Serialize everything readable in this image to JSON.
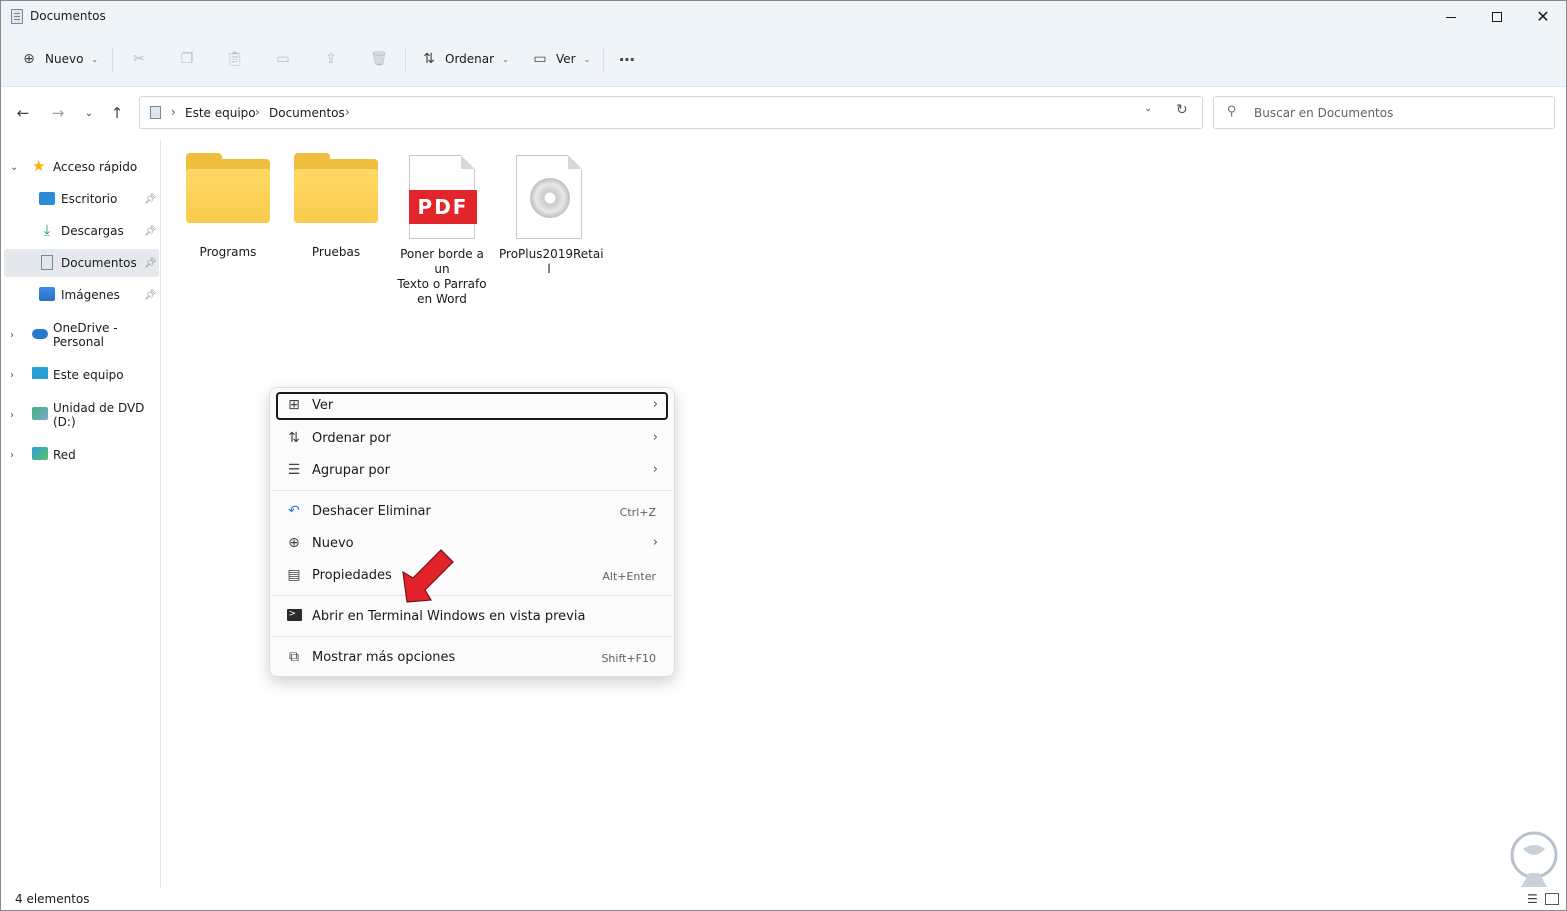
{
  "window": {
    "title": "Documentos"
  },
  "toolbar": {
    "new_label": "Nuevo",
    "sort_label": "Ordenar",
    "view_label": "Ver",
    "icons": [
      "add-icon",
      "cut-icon",
      "copy-icon",
      "paste-icon",
      "rename-icon",
      "share-icon",
      "delete-icon",
      "sort-icon",
      "view-icon",
      "more-icon"
    ]
  },
  "address": {
    "crumbs": [
      "Este equipo",
      "Documentos"
    ],
    "search_placeholder": "Buscar en Documentos"
  },
  "sidebar": {
    "quick_access": "Acceso rápido",
    "items": [
      {
        "label": "Escritorio",
        "pinned": true,
        "selected": false
      },
      {
        "label": "Descargas",
        "pinned": true,
        "selected": false
      },
      {
        "label": "Documentos",
        "pinned": true,
        "selected": true
      },
      {
        "label": "Imágenes",
        "pinned": true,
        "selected": false
      }
    ],
    "sections": [
      "OneDrive - Personal",
      "Este equipo",
      "Unidad de DVD (D:)",
      "Red"
    ]
  },
  "files": [
    {
      "name": "Programs",
      "type": "folder"
    },
    {
      "name": "Pruebas",
      "type": "folder"
    },
    {
      "name_lines": [
        "Poner borde a un",
        "Texto o Parrafo",
        "en Word"
      ],
      "type": "pdf",
      "badge": "PDF"
    },
    {
      "name_lines": [
        "ProPlus2019Retai",
        "l"
      ],
      "type": "disc-image"
    }
  ],
  "context_menu": {
    "items": [
      {
        "label": "Ver",
        "submenu": true,
        "icon": "grid-icon"
      },
      {
        "label": "Ordenar por",
        "submenu": true,
        "icon": "sort-icon"
      },
      {
        "label": "Agrupar por",
        "submenu": true,
        "icon": "group-icon"
      },
      {
        "label": "Deshacer Eliminar",
        "shortcut": "Ctrl+Z",
        "icon": "undo-icon"
      },
      {
        "label": "Nuevo",
        "submenu": true,
        "icon": "add-icon"
      },
      {
        "label": "Propiedades",
        "shortcut": "Alt+Enter",
        "icon": "properties-icon"
      },
      {
        "label": "Abrir en Terminal Windows en vista previa",
        "icon": "terminal-icon"
      },
      {
        "label": "Mostrar más opciones",
        "shortcut": "Shift+F10",
        "icon": "more-options-icon"
      }
    ]
  },
  "status": {
    "count": "4 elementos"
  },
  "colors": {
    "accent_arrow": "#e3232b",
    "folder": "#f9cb4c",
    "pdf": "#e2252b",
    "toolbar_bg": "#eff4f9"
  }
}
